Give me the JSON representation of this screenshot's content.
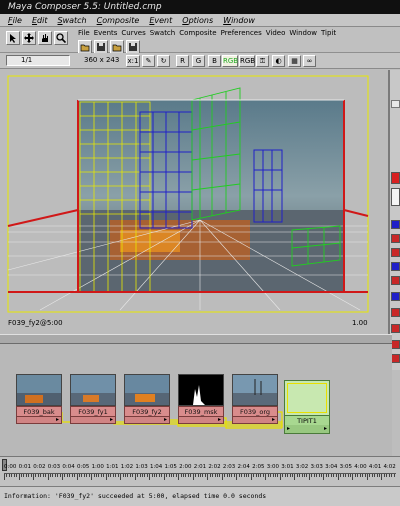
{
  "window": {
    "title": "Maya Composer 5.5: Untitled.cmp"
  },
  "main_menu": [
    {
      "ul": "F",
      "rest": "ile"
    },
    {
      "ul": "E",
      "rest": "dit"
    },
    {
      "ul": "S",
      "rest": "watch"
    },
    {
      "ul": "C",
      "rest": "omposite"
    },
    {
      "ul": "E",
      "rest": "vent"
    },
    {
      "ul": "O",
      "rest": "ptions"
    },
    {
      "ul": "W",
      "rest": "indow"
    }
  ],
  "viewer_menu": [
    "File",
    "Events",
    "Curves",
    "Swatch",
    "Composite",
    "Preferences",
    "Video",
    "Window",
    "Tipit"
  ],
  "toolbar_icons": [
    "pointer-icon",
    "move-icon",
    "hand-icon",
    "magnify-icon",
    "folder-open-icon",
    "save-icon",
    "folder-icon",
    "save-as-icon"
  ],
  "viewer_buttons": {
    "r": "R",
    "g": "G",
    "b": "B",
    "rgb1": "RGB",
    "rgb2": "RGB",
    "icons": [
      "key-icon",
      "mask-icon",
      "checker-icon",
      "glasses-icon"
    ]
  },
  "view_controls": {
    "frame_value": "1/1",
    "resolution": "360 x 243",
    "zoom": "x:1"
  },
  "viewer": {
    "name": "F039_fy2@5:00",
    "zoom": "1.00"
  },
  "nodes": [
    {
      "label": "F039_bak"
    },
    {
      "label": "F039_fy1"
    },
    {
      "label": "F039_fy2"
    },
    {
      "label": "F039_msk"
    },
    {
      "label": "F039_org"
    }
  ],
  "tipit_node": {
    "label": "TIPIT1"
  },
  "timeline": {
    "ticks": [
      "0:00",
      "0:01",
      "0:02",
      "0:03",
      "0:04",
      "0:05",
      "1:00",
      "1:01",
      "1:02",
      "1:03",
      "1:04",
      "1:05",
      "2:00",
      "2:01",
      "2:02",
      "2:03",
      "2:04",
      "2:05",
      "3:00",
      "3:01",
      "3:02",
      "3:03",
      "3:04",
      "3:05",
      "4:00",
      "4:01",
      "4:02"
    ]
  },
  "status": {
    "message": "Information: 'F039_fy2' succeeded at 5:00, elapsed time 0.0 seconds"
  },
  "colors": {
    "frame_red": "#d01818",
    "grid_yellow": "#e8e800",
    "grid_blue": "#2020c8",
    "grid_green": "#22cc22",
    "node_red": "#d98c8c",
    "node_green": "#c8e8b0",
    "link_yellow": "#e8e000"
  }
}
